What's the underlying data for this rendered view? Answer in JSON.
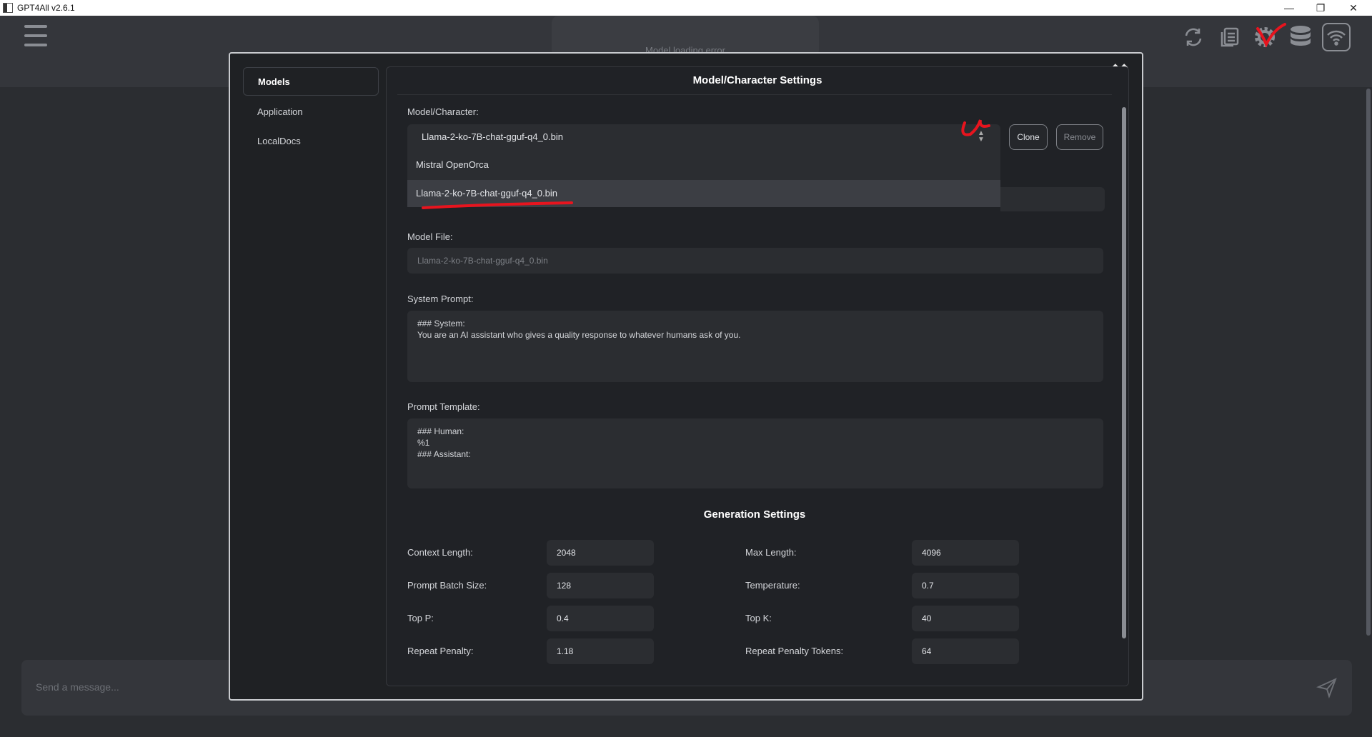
{
  "window": {
    "title": "GPT4All v2.6.1"
  },
  "header": {
    "status_text": "Model loading error"
  },
  "composer": {
    "placeholder": "Send a message..."
  },
  "dialog": {
    "nav": [
      "Models",
      "Application",
      "LocalDocs"
    ],
    "title": "Model/Character Settings",
    "model_label": "Model/Character:",
    "selected_model": "Llama-2-ko-7B-chat-gguf-q4_0.bin",
    "dropdown_options": [
      "Mistral OpenOrca",
      "Llama-2-ko-7B-chat-gguf-q4_0.bin"
    ],
    "clone_label": "Clone",
    "remove_label": "Remove",
    "model_file_label": "Model File:",
    "model_file_value": "Llama-2-ko-7B-chat-gguf-q4_0.bin",
    "system_prompt_label": "System Prompt:",
    "system_prompt_value": "### System:\nYou are an AI assistant who gives a quality response to whatever humans ask of you.",
    "prompt_template_label": "Prompt Template:",
    "prompt_template_value": "### Human:\n%1\n### Assistant:",
    "generation_title": "Generation Settings",
    "settings": {
      "context_length": {
        "label": "Context Length:",
        "value": "2048"
      },
      "max_length": {
        "label": "Max Length:",
        "value": "4096"
      },
      "prompt_batch_size": {
        "label": "Prompt Batch Size:",
        "value": "128"
      },
      "temperature": {
        "label": "Temperature:",
        "value": "0.7"
      },
      "top_p": {
        "label": "Top P:",
        "value": "0.4"
      },
      "top_k": {
        "label": "Top K:",
        "value": "40"
      },
      "repeat_penalty": {
        "label": "Repeat Penalty:",
        "value": "1.18"
      },
      "repeat_penalty_tokens": {
        "label": "Repeat Penalty Tokens:",
        "value": "64"
      }
    }
  },
  "icons": [
    "hamburger-icon",
    "refresh-icon",
    "copy-icon",
    "gear-icon",
    "database-icon",
    "wifi-icon",
    "send-icon",
    "close-icon",
    "chevron-updown-icon"
  ],
  "colors": {
    "annotation": "#e8141e",
    "background": "#2b2d31",
    "dialog": "#1f2124"
  }
}
